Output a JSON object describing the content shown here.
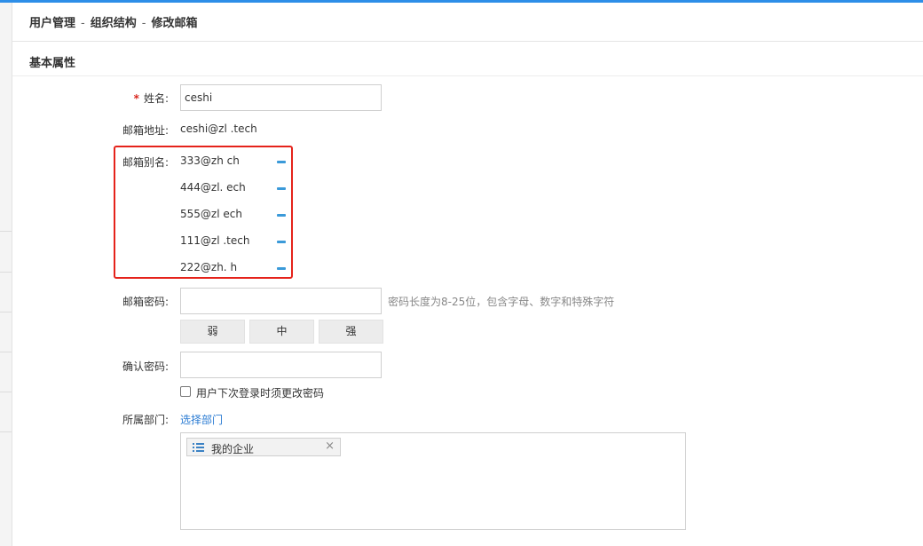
{
  "breadcrumb": {
    "part1": "用户管理",
    "sep1": "-",
    "part2": "组织结构",
    "sep2": "-",
    "part3": "修改邮箱"
  },
  "section": {
    "title": "基本属性"
  },
  "name_field": {
    "required_mark": "*",
    "label": "姓名:",
    "value": "ceshi"
  },
  "email_field": {
    "label": "邮箱地址:",
    "value": "ceshi@zl .tech"
  },
  "alias_field": {
    "label": "邮箱别名:",
    "items": [
      "333@zh ch",
      "444@zl. ech",
      "555@zl ech",
      "111@zl .tech",
      "222@zh. h"
    ],
    "remove_icon": "minus-icon"
  },
  "password_field": {
    "label": "邮箱密码:",
    "hint": "密码长度为8-25位，包含字母、数字和特殊字符"
  },
  "strength": {
    "weak": "弱",
    "medium": "中",
    "strong": "强"
  },
  "confirm_field": {
    "label": "确认密码:"
  },
  "force_change": {
    "label": "用户下次登录时须更改密码",
    "checked": false
  },
  "department": {
    "label": "所属部门:",
    "select_link": "选择部门",
    "selected_tag": "我的企业",
    "tag_icon": "list-icon",
    "close_symbol": "×"
  },
  "colors": {
    "accent": "#2d8ee8",
    "highlight_border": "#e5231b",
    "link": "#2b7cd3",
    "minus": "#3b9ad9"
  }
}
